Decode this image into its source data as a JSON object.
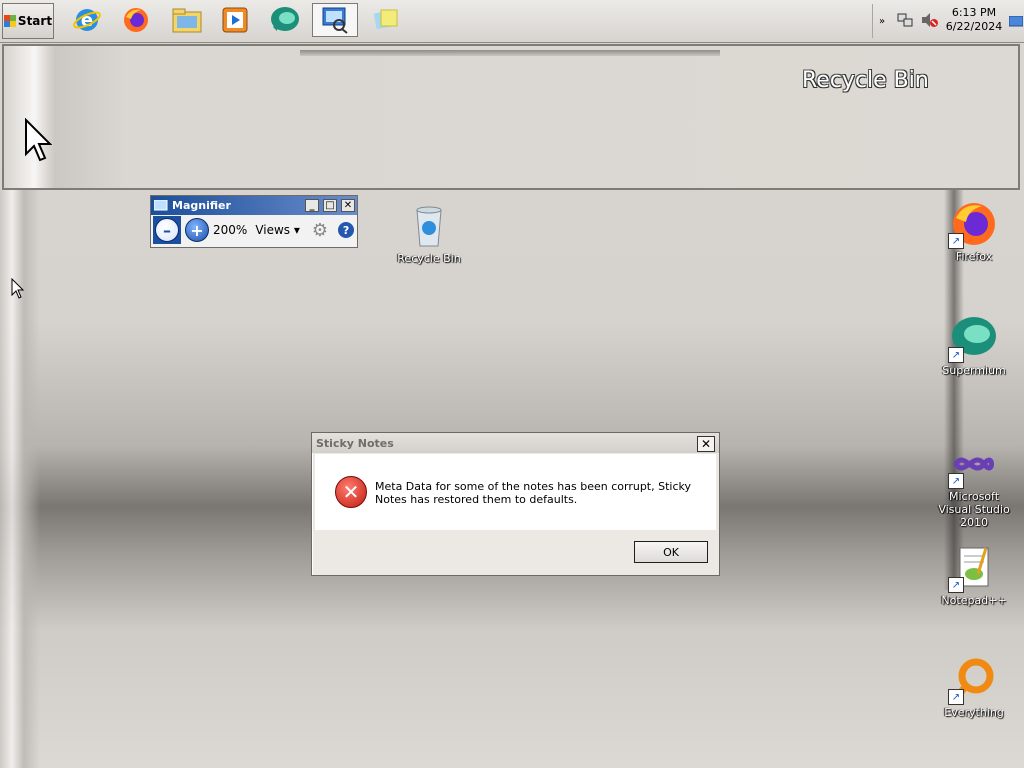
{
  "taskbar": {
    "start_label": "Start",
    "apps": [
      {
        "name": "internet-explorer-icon"
      },
      {
        "name": "firefox-icon"
      },
      {
        "name": "file-explorer-icon"
      },
      {
        "name": "media-player-icon"
      },
      {
        "name": "supermium-icon"
      },
      {
        "name": "magnifier-icon",
        "active": true
      },
      {
        "name": "sticky-notes-icon"
      }
    ],
    "clock": {
      "time": "6:13 PM",
      "date": "6/22/2024"
    }
  },
  "magnifier_lens": {
    "recycle_bin_label": "Recycle Bin"
  },
  "magnifier": {
    "title": "Magnifier",
    "zoom": "200%",
    "views_label": "Views"
  },
  "desktop_icons": {
    "recycle_bin": "Recycle Bin",
    "firefox": "Firefox",
    "supermium": "Supermium",
    "visual_studio": "Microsoft Visual Studio 2010",
    "notepadpp": "Notepad++",
    "everything": "Everything"
  },
  "dialog": {
    "title": "Sticky Notes",
    "message": "Meta Data for some of the notes has been corrupt, Sticky Notes has restored them to defaults.",
    "ok_label": "OK"
  },
  "colors": {
    "title_bar": "#1c4f9a",
    "error_red": "#c01c12"
  }
}
